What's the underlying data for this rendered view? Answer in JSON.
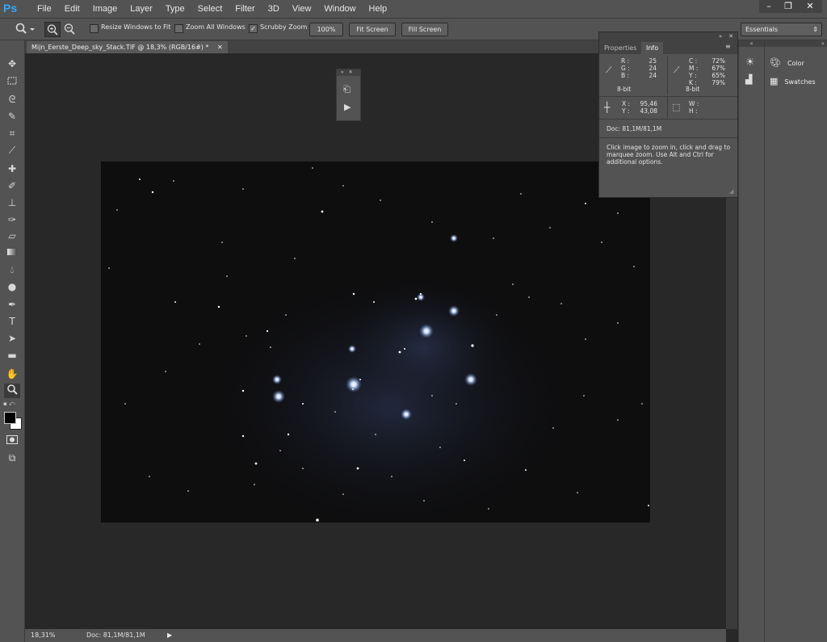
{
  "app": {
    "logo": "Ps"
  },
  "menu": [
    "File",
    "Edit",
    "Image",
    "Layer",
    "Type",
    "Select",
    "Filter",
    "3D",
    "View",
    "Window",
    "Help"
  ],
  "window_controls": {
    "minimize": "–",
    "restore": "❐",
    "close": "✕"
  },
  "options": {
    "resize_windows": "Resize Windows to Fit",
    "zoom_all": "Zoom All Windows",
    "scrubby": "Scrubby Zoom",
    "btn_100": "100%",
    "btn_fit": "Fit Screen",
    "btn_fill": "Fill Screen",
    "workspace": "Essentials"
  },
  "document": {
    "tab_title": "Mijn_Eerste_Deep_sky_Stack.TIF @ 18,3% (RGB/16#) *"
  },
  "status": {
    "zoom": "18,31%",
    "doc": "Doc: 81,1M/81,1M"
  },
  "info_panel": {
    "tabs": [
      "Properties",
      "Info"
    ],
    "rgb": {
      "r_label": "R :",
      "r": "25",
      "g_label": "G :",
      "g": "24",
      "b_label": "B :",
      "b": "24",
      "bit": "8-bit"
    },
    "cmyk": {
      "c_label": "C :",
      "c": "72%",
      "m_label": "M :",
      "m": "67%",
      "y_label": "Y :",
      "y": "65%",
      "k_label": "K :",
      "k": "79%",
      "bit": "8-bit"
    },
    "pos": {
      "x_label": "X :",
      "x": "95,46",
      "y_label": "Y :",
      "y": "43,08"
    },
    "size": {
      "w_label": "W :",
      "h_label": "H :"
    },
    "doc": "Doc: 81,1M/81,1M",
    "hint": "Click image to zoom in, click and drag to marquee zoom.  Use Alt and Ctrl for additional options."
  },
  "right_panels": {
    "color": "Color",
    "swatches": "Swatches"
  }
}
